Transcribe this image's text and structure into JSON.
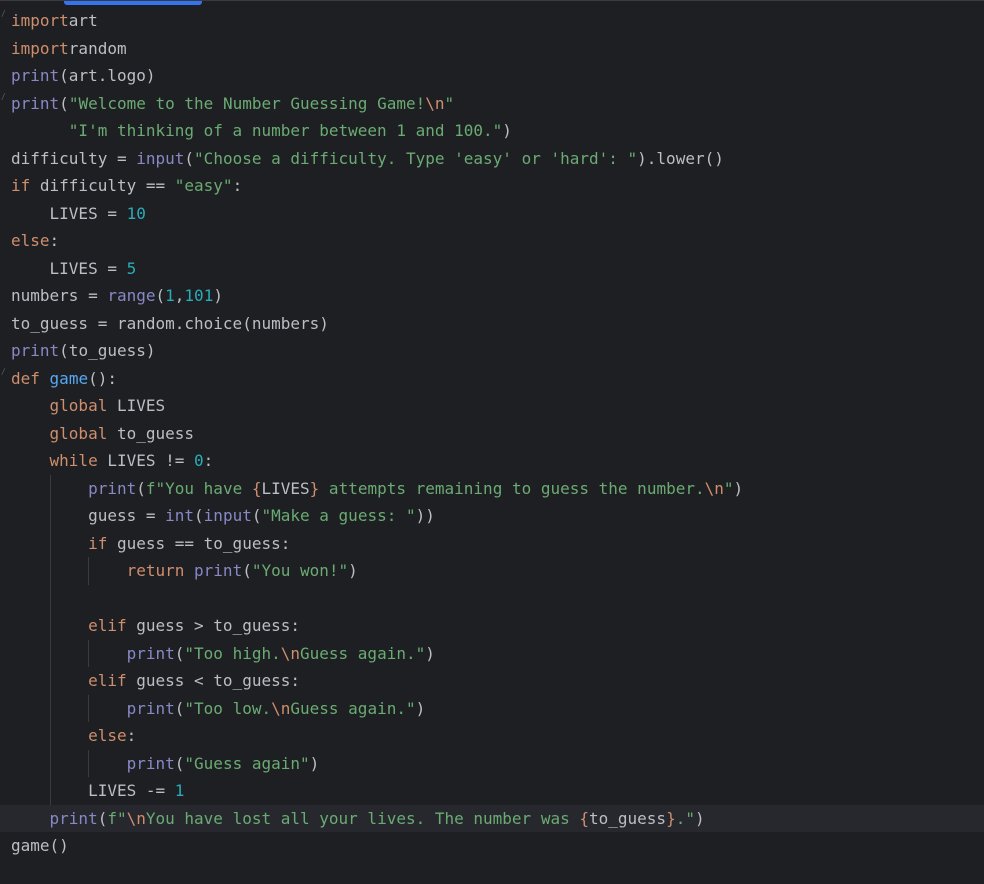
{
  "editor": {
    "colors": {
      "background": "#1e1f22",
      "current_line": "#26282e",
      "text": "#bcbec4",
      "keyword": "#cf8e6d",
      "function_def": "#56a8f5",
      "builtin": "#8888c6",
      "string": "#6aab73",
      "number": "#2aacb8",
      "scroll_thumb": "#3574f0"
    },
    "lines": [
      {
        "name": "code-line-1",
        "fold": true,
        "tokens": [
          [
            "kw",
            "import"
          ],
          [
            "",
            "art"
          ]
        ]
      },
      {
        "name": "code-line-2",
        "tokens": [
          [
            "kw",
            "import"
          ],
          [
            "",
            "random"
          ]
        ]
      },
      {
        "name": "code-line-3",
        "tokens": [
          [
            "bi",
            "print"
          ],
          [
            "",
            "(art.logo)"
          ]
        ]
      },
      {
        "name": "code-line-4",
        "fold": true,
        "tokens": [
          [
            "bi",
            "print"
          ],
          [
            "",
            "("
          ],
          [
            "str",
            "\"Welcome to the Number Guessing Game!"
          ],
          [
            "esc",
            "\\n"
          ],
          [
            "str",
            "\""
          ]
        ]
      },
      {
        "name": "code-line-5",
        "tokens": [
          [
            "",
            "      "
          ],
          [
            "str",
            "\"I'm thinking of a number between 1 and 100.\""
          ],
          [
            "",
            ")"
          ]
        ]
      },
      {
        "name": "code-line-6",
        "tokens": [
          [
            "",
            "difficulty = "
          ],
          [
            "bi",
            "input"
          ],
          [
            "",
            "("
          ],
          [
            "str",
            "\"Choose a difficulty. Type 'easy' or 'hard': \""
          ],
          [
            "",
            ").lower()"
          ]
        ]
      },
      {
        "name": "code-line-7",
        "tokens": [
          [
            "kw",
            "if"
          ],
          [
            "",
            " difficulty == "
          ],
          [
            "str",
            "\"easy\""
          ],
          [
            "",
            ":"
          ]
        ]
      },
      {
        "name": "code-line-8",
        "tokens": [
          [
            "",
            "    LIVES = "
          ],
          [
            "num",
            "10"
          ]
        ]
      },
      {
        "name": "code-line-9",
        "tokens": [
          [
            "kw",
            "else"
          ],
          [
            "",
            ":"
          ]
        ]
      },
      {
        "name": "code-line-10",
        "tokens": [
          [
            "",
            "    LIVES = "
          ],
          [
            "num",
            "5"
          ]
        ]
      },
      {
        "name": "code-line-11",
        "tokens": [
          [
            "",
            "numbers = "
          ],
          [
            "bi",
            "range"
          ],
          [
            "",
            "("
          ],
          [
            "num",
            "1"
          ],
          [
            "",
            ","
          ],
          [
            "num",
            "101"
          ],
          [
            "",
            ")"
          ]
        ]
      },
      {
        "name": "code-line-12",
        "tokens": [
          [
            "",
            "to_guess = random.choice(numbers)"
          ]
        ]
      },
      {
        "name": "code-line-13",
        "tokens": [
          [
            "bi",
            "print"
          ],
          [
            "",
            "(to_guess)"
          ]
        ]
      },
      {
        "name": "code-line-14",
        "fold": true,
        "tokens": [
          [
            "kw",
            "def"
          ],
          [
            "",
            " "
          ],
          [
            "fn",
            "game"
          ],
          [
            "",
            "():"
          ]
        ]
      },
      {
        "name": "code-line-15",
        "tokens": [
          [
            "",
            "    "
          ],
          [
            "kw",
            "global"
          ],
          [
            "",
            " LIVES"
          ]
        ]
      },
      {
        "name": "code-line-16",
        "tokens": [
          [
            "",
            "    "
          ],
          [
            "kw",
            "global"
          ],
          [
            "",
            " to_guess"
          ]
        ]
      },
      {
        "name": "code-line-17",
        "tokens": [
          [
            "",
            "    "
          ],
          [
            "kw",
            "while"
          ],
          [
            "",
            " LIVES != "
          ],
          [
            "num",
            "0"
          ],
          [
            "",
            ":"
          ]
        ]
      },
      {
        "name": "code-line-18",
        "tokens": [
          [
            "",
            "        "
          ],
          [
            "bi",
            "print"
          ],
          [
            "",
            "("
          ],
          [
            "str",
            "f\"You have "
          ],
          [
            "esc",
            "{"
          ],
          [
            "",
            "LIVES"
          ],
          [
            "esc",
            "}"
          ],
          [
            "str",
            " attempts remaining to guess the number."
          ],
          [
            "esc",
            "\\n"
          ],
          [
            "str",
            "\""
          ],
          [
            "",
            ")"
          ]
        ]
      },
      {
        "name": "code-line-19",
        "tokens": [
          [
            "",
            "        guess = "
          ],
          [
            "bi",
            "int"
          ],
          [
            "",
            "("
          ],
          [
            "bi",
            "input"
          ],
          [
            "",
            "("
          ],
          [
            "str",
            "\"Make a guess: \""
          ],
          [
            "",
            "))"
          ]
        ]
      },
      {
        "name": "code-line-20",
        "tokens": [
          [
            "",
            "        "
          ],
          [
            "kw",
            "if"
          ],
          [
            "",
            " guess == to_guess:"
          ]
        ]
      },
      {
        "name": "code-line-21",
        "tokens": [
          [
            "",
            "            "
          ],
          [
            "kw",
            "return"
          ],
          [
            "",
            " "
          ],
          [
            "bi",
            "print"
          ],
          [
            "",
            "("
          ],
          [
            "str",
            "\"You won!\""
          ],
          [
            "",
            ")"
          ]
        ]
      },
      {
        "name": "code-line-22",
        "tokens": []
      },
      {
        "name": "code-line-23",
        "tokens": [
          [
            "",
            "        "
          ],
          [
            "kw",
            "elif"
          ],
          [
            "",
            " guess > to_guess:"
          ]
        ]
      },
      {
        "name": "code-line-24",
        "tokens": [
          [
            "",
            "            "
          ],
          [
            "bi",
            "print"
          ],
          [
            "",
            "("
          ],
          [
            "str",
            "\"Too high."
          ],
          [
            "esc",
            "\\n"
          ],
          [
            "str",
            "Guess again.\""
          ],
          [
            "",
            ")"
          ]
        ]
      },
      {
        "name": "code-line-25",
        "tokens": [
          [
            "",
            "        "
          ],
          [
            "kw",
            "elif"
          ],
          [
            "",
            " guess < to_guess:"
          ]
        ]
      },
      {
        "name": "code-line-26",
        "tokens": [
          [
            "",
            "            "
          ],
          [
            "bi",
            "print"
          ],
          [
            "",
            "("
          ],
          [
            "str",
            "\"Too low."
          ],
          [
            "esc",
            "\\n"
          ],
          [
            "str",
            "Guess again.\""
          ],
          [
            "",
            ")"
          ]
        ]
      },
      {
        "name": "code-line-27",
        "tokens": [
          [
            "",
            "        "
          ],
          [
            "kw",
            "else"
          ],
          [
            "",
            ":"
          ]
        ]
      },
      {
        "name": "code-line-28",
        "tokens": [
          [
            "",
            "            "
          ],
          [
            "bi",
            "print"
          ],
          [
            "",
            "("
          ],
          [
            "str",
            "\"Guess again\""
          ],
          [
            "",
            ")"
          ]
        ]
      },
      {
        "name": "code-line-29",
        "tokens": [
          [
            "",
            "        LIVES -= "
          ],
          [
            "num",
            "1"
          ]
        ]
      },
      {
        "name": "code-line-30",
        "current": true,
        "tokens": [
          [
            "",
            "    "
          ],
          [
            "bi",
            "print"
          ],
          [
            "",
            "("
          ],
          [
            "str",
            "f\""
          ],
          [
            "esc",
            "\\n"
          ],
          [
            "str",
            "You have lost all your lives. The number was "
          ],
          [
            "esc",
            "{"
          ],
          [
            "",
            "to_guess"
          ],
          [
            "esc",
            "}"
          ],
          [
            "str",
            ".\""
          ],
          [
            "",
            ")"
          ]
        ]
      },
      {
        "name": "code-line-31",
        "tokens": [
          [
            "",
            "game()"
          ]
        ]
      }
    ]
  }
}
